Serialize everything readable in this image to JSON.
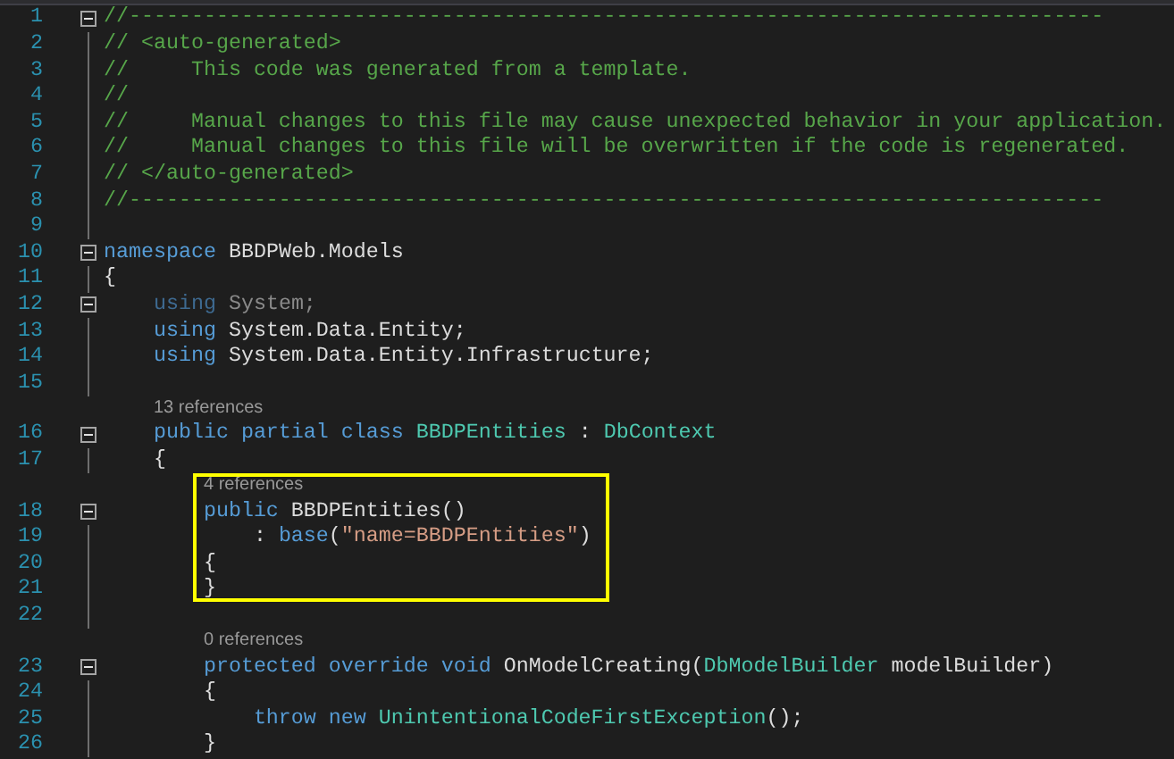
{
  "lines": [
    {
      "number": "1",
      "expanded": true,
      "tokens": [
        {
          "kind": "comment",
          "text": "//------------------------------------------------------------------------------"
        }
      ]
    },
    {
      "number": "2",
      "tokens": [
        {
          "kind": "comment",
          "text": "// <auto-generated>"
        }
      ]
    },
    {
      "number": "3",
      "tokens": [
        {
          "kind": "comment",
          "text": "//     This code was generated from a template."
        }
      ]
    },
    {
      "number": "4",
      "tokens": [
        {
          "kind": "comment",
          "text": "//"
        }
      ]
    },
    {
      "number": "5",
      "tokens": [
        {
          "kind": "comment",
          "text": "//     Manual changes to this file may cause unexpected behavior in your application."
        }
      ]
    },
    {
      "number": "6",
      "tokens": [
        {
          "kind": "comment",
          "text": "//     Manual changes to this file will be overwritten if the code is regenerated."
        }
      ]
    },
    {
      "number": "7",
      "tokens": [
        {
          "kind": "comment",
          "text": "// </auto-generated>"
        }
      ]
    },
    {
      "number": "8",
      "tokens": [
        {
          "kind": "comment",
          "text": "//------------------------------------------------------------------------------"
        }
      ]
    },
    {
      "number": "9"
    },
    {
      "number": "10",
      "expanded": true,
      "tokens": [
        {
          "kind": "keyword",
          "text": "namespace"
        },
        {
          "kind": "plain",
          "text": " BBDPWeb.Models"
        }
      ]
    },
    {
      "number": "11",
      "tokens": [
        {
          "kind": "plain",
          "text": "{"
        }
      ]
    },
    {
      "number": "12",
      "expanded": true,
      "tokens": [
        {
          "kind": "unused_keyword",
          "text": "    using"
        },
        {
          "kind": "unused",
          "text": " System;"
        }
      ]
    },
    {
      "number": "13",
      "tokens": [
        {
          "kind": "keyword",
          "text": "    using"
        },
        {
          "kind": "plain",
          "text": " System.Data.Entity;"
        }
      ]
    },
    {
      "number": "14",
      "tokens": [
        {
          "kind": "keyword",
          "text": "    using"
        },
        {
          "kind": "plain",
          "text": " System.Data.Entity.Infrastructure;"
        }
      ]
    },
    {
      "number": "15"
    },
    {
      "number": "16",
      "lens": "13 references",
      "expanded": true,
      "tokens": [
        {
          "kind": "keyword",
          "text": "    public partial class "
        },
        {
          "kind": "type",
          "text": "BBDPEntities"
        },
        {
          "kind": "plain",
          "text": " : "
        },
        {
          "kind": "type",
          "text": "DbContext"
        }
      ]
    },
    {
      "number": "17",
      "tokens": [
        {
          "kind": "plain",
          "text": "    {"
        }
      ]
    },
    {
      "number": "18",
      "lens": "4 references",
      "expanded": true,
      "highlighted": true,
      "tokens": [
        {
          "kind": "keyword",
          "text": "        public"
        },
        {
          "kind": "plain",
          "text": " BBDPEntities()"
        }
      ]
    },
    {
      "number": "19",
      "highlighted": true,
      "tokens": [
        {
          "kind": "plain",
          "text": "            : "
        },
        {
          "kind": "keyword",
          "text": "base"
        },
        {
          "kind": "plain",
          "text": "("
        },
        {
          "kind": "string",
          "text": "\"name=BBDPEntities\""
        },
        {
          "kind": "plain",
          "text": ")"
        }
      ]
    },
    {
      "number": "20",
      "highlighted": true,
      "tokens": [
        {
          "kind": "plain",
          "text": "        {"
        }
      ]
    },
    {
      "number": "21",
      "highlighted": true,
      "tokens": [
        {
          "kind": "plain",
          "text": "        }"
        }
      ]
    },
    {
      "number": "22"
    },
    {
      "number": "23",
      "lens": "0 references",
      "expanded": true,
      "tokens": [
        {
          "kind": "keyword",
          "text": "        protected override void"
        },
        {
          "kind": "plain",
          "text": " OnModelCreating("
        },
        {
          "kind": "type",
          "text": "DbModelBuilder"
        },
        {
          "kind": "plain",
          "text": " modelBuilder)"
        }
      ]
    },
    {
      "number": "24",
      "tokens": [
        {
          "kind": "plain",
          "text": "        {"
        }
      ]
    },
    {
      "number": "25",
      "tokens": [
        {
          "kind": "keyword",
          "text": "            throw new "
        },
        {
          "kind": "type",
          "text": "UnintentionalCodeFirstException"
        },
        {
          "kind": "plain",
          "text": "();"
        }
      ]
    },
    {
      "number": "26",
      "tokens": [
        {
          "kind": "plain",
          "text": "        }"
        }
      ]
    }
  ]
}
